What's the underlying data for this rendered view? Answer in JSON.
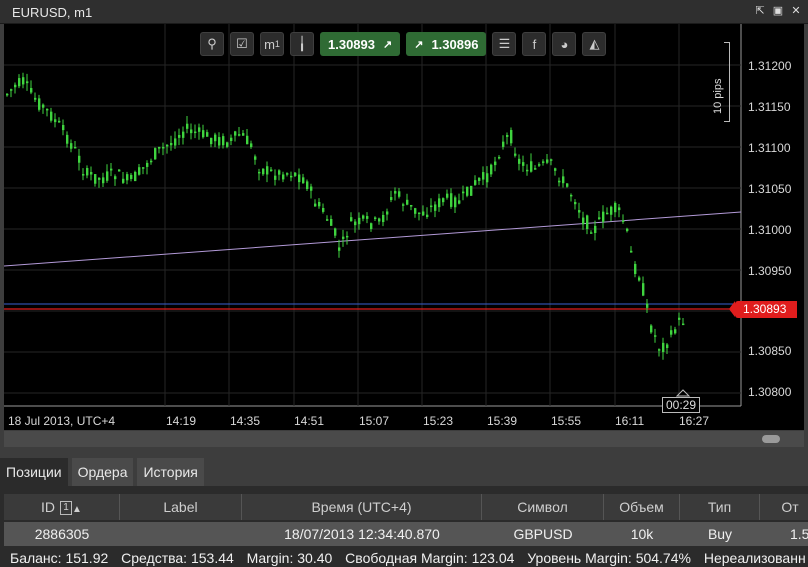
{
  "window": {
    "title": "EURUSD, m1"
  },
  "window_buttons": [
    "maximize-icon",
    "restore-icon",
    "close-icon"
  ],
  "toolbar": {
    "icons": [
      "zoom-icon",
      "chart-settings-icon",
      "timeframe-icon",
      "candles-icon"
    ],
    "timeframe_label": "m",
    "timeframe_sub": "1",
    "sell_price": "1.30893",
    "buy_price": "1.30896",
    "right_icons": [
      "order-list-icon",
      "facebook-icon",
      "share-icon",
      "signal-icon"
    ]
  },
  "pips_label": "10 pips",
  "y_axis": [
    "1.31200",
    "1.31150",
    "1.31100",
    "1.31050",
    "1.31000",
    "1.30950",
    "1.30850",
    "1.30800"
  ],
  "x_axis": [
    "18 Jul 2013, UTC+4",
    "14:19",
    "14:35",
    "14:51",
    "15:07",
    "15:23",
    "15:39",
    "15:55",
    "16:11",
    "16:27"
  ],
  "current_price": "1.30893",
  "time_countdown": "00:29",
  "colors": {
    "bull": "#3fd43f",
    "bear": "#3fd43f",
    "bid_line": "#e01d1d",
    "ask_line": "#3a5fd0",
    "trend": "#b39ad8"
  },
  "tabs": [
    {
      "label": "Позиции",
      "active": true
    },
    {
      "label": "Ордера",
      "active": false
    },
    {
      "label": "История",
      "active": false
    }
  ],
  "table": {
    "headers": [
      "ID",
      "Label",
      "Время (UTC+4)",
      "Символ",
      "Объем",
      "Тип",
      "От"
    ],
    "sort_index": "1",
    "rows": [
      [
        "2886305",
        "",
        "18/07/2013 12:34:40.870",
        "GBPUSD",
        "10k",
        "Buy",
        "1.5"
      ]
    ]
  },
  "status_bar": [
    "Баланс: 151.92",
    "Средства: 153.44",
    "Margin: 30.40",
    "Свободная Margin: 123.04",
    "Уровень Margin: 504.74%",
    "Нереализованн"
  ]
}
